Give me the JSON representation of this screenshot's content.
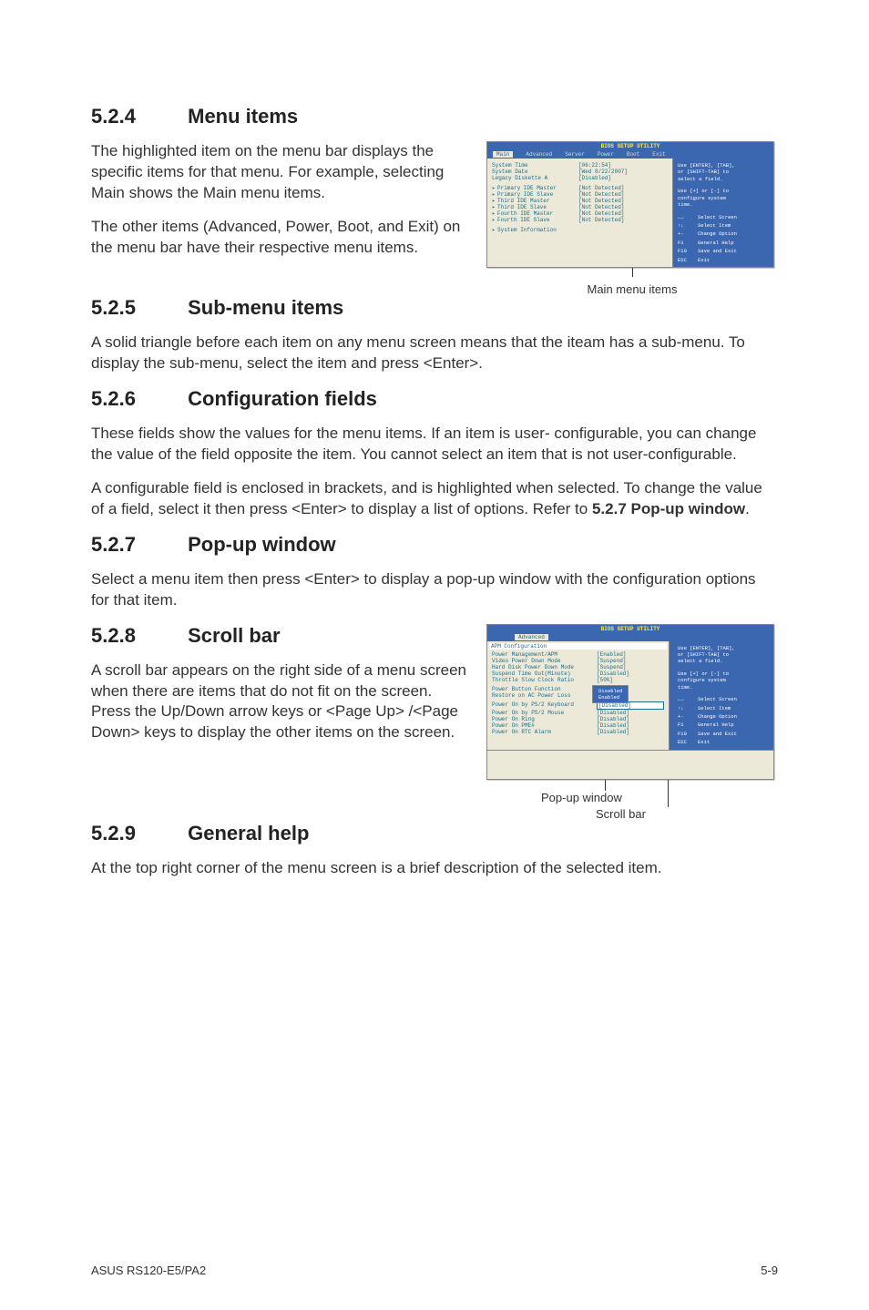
{
  "sections": {
    "s524": {
      "num": "5.2.4",
      "title": "Menu items"
    },
    "s525": {
      "num": "5.2.5",
      "title": "Sub-menu items"
    },
    "s526": {
      "num": "5.2.6",
      "title": "Configuration fields"
    },
    "s527": {
      "num": "5.2.7",
      "title": "Pop-up window"
    },
    "s528": {
      "num": "5.2.8",
      "title": "Scroll bar"
    },
    "s529": {
      "num": "5.2.9",
      "title": "General help"
    }
  },
  "para": {
    "p524a": "The highlighted item on the menu bar displays the specific items for that menu. For example, selecting Main shows the Main menu items.",
    "p524b": "The other items (Advanced, Power, Boot, and Exit) on the menu bar have their respective menu items.",
    "p525": "A solid triangle before each item on any menu screen means that the iteam has a sub-menu. To display the sub-menu, select the item and press <Enter>.",
    "p526a": "These fields show the values for the menu items. If an item is user- configurable, you can change the value of the field opposite the item. You cannot select an item that is not user-configurable.",
    "p526b_pre": "A configurable field is enclosed in brackets, and is highlighted when selected. To change the value of a field, select it then press <Enter> to display a list of options. Refer to ",
    "p526b_bold": "5.2.7 Pop-up window",
    "p526b_post": ".",
    "p527": "Select a menu item then press <Enter> to display a pop-up window with the configuration options for that item.",
    "p528": "A scroll bar appears on the right side of a menu screen when there are items that do not fit on the screen. Press the Up/Down arrow keys or <Page Up> /<Page Down> keys to display the other items on the screen.",
    "p529": "At the top right corner of the menu screen is a brief description of the selected item."
  },
  "fig1": {
    "caption": "Main menu items",
    "title": "BIOS SETUP UTILITY",
    "menus": {
      "main": "Main",
      "advanced": "Advanced",
      "server": "Server",
      "power": "Power",
      "boot": "Boot",
      "exit": "Exit"
    },
    "rows": [
      {
        "lbl": "System Time",
        "val": "[06:22:54]"
      },
      {
        "lbl": "System Date",
        "val": "[Wed 8/22/2007]"
      },
      {
        "lbl": "Legacy Diskette A",
        "val": "[Disabled]"
      }
    ],
    "subrows": [
      {
        "lbl": "Primary IDE Master",
        "val": "[Not Detected]"
      },
      {
        "lbl": "Primary IDE Slave",
        "val": "[Not Detected]"
      },
      {
        "lbl": "Third IDE Master",
        "val": "[Not Detected]"
      },
      {
        "lbl": "Third IDE Slave",
        "val": "[Not Detected]"
      },
      {
        "lbl": "Fourth IDE Master",
        "val": "[Not Detected]"
      },
      {
        "lbl": "Fourth IDE Slave",
        "val": "[Not Detected]"
      }
    ],
    "sysinfo": "System Information",
    "help": {
      "top1": "Use [ENTER], [TAB],",
      "top2": "or [SHIFT-TAB] to",
      "top3": "select a field.",
      "mid1": "Use [+] or [-] to",
      "mid2": "configure system",
      "mid3": "time.",
      "keys": [
        {
          "k": "←→",
          "d": "Select Screen"
        },
        {
          "k": "↑↓",
          "d": "Select Item"
        },
        {
          "k": "+-",
          "d": "Change Option"
        },
        {
          "k": "F1",
          "d": "General Help"
        },
        {
          "k": "F10",
          "d": "Save and Exit"
        },
        {
          "k": "ESC",
          "d": "Exit"
        }
      ]
    }
  },
  "fig2": {
    "caption_popup": "Pop-up window",
    "caption_scroll": "Scroll bar",
    "title": "BIOS SETUP UTILITY",
    "tab": "Advanced",
    "header": "APM Configuration",
    "rows": [
      {
        "lbl": "Power Management/APM",
        "val": "[Enabled]"
      },
      {
        "lbl": "Video Power Down Mode",
        "val": "[Suspend]"
      },
      {
        "lbl": "Hard Disk Power Down Mode",
        "val": "[Suspend]"
      },
      {
        "lbl": "Suspend Time Out(Minute)",
        "val": "[Disabled]"
      },
      {
        "lbl": "Throttle Slow Clock Ratio",
        "val": "[50%]"
      }
    ],
    "rows2": [
      {
        "lbl": "Power Button Function",
        "val": ""
      },
      {
        "lbl": "Restore on AC Power Loss",
        "val": ""
      }
    ],
    "rows3": [
      {
        "lbl": "Power On by PS/2 Keyboard",
        "val": "[Disabled]"
      },
      {
        "lbl": "Power On by PS/2 Mouse",
        "val": "[Disabled]"
      },
      {
        "lbl": "Power On Ring",
        "val": "[Disabled]"
      },
      {
        "lbl": "Power On PME#",
        "val": "[Disabled]"
      },
      {
        "lbl": "Power On RTC Alarm",
        "val": "[Disabled]"
      }
    ],
    "popup": {
      "opt1": "Disabled",
      "opt2": "Enabled"
    },
    "help": {
      "top1": "Use [ENTER], [TAB],",
      "top2": "or [SHIFT-TAB] to",
      "top3": "select a field.",
      "mid1": "Use [+] or [-] to",
      "mid2": "configure system",
      "mid3": "time.",
      "keys": [
        {
          "k": "←→",
          "d": "Select Screen"
        },
        {
          "k": "↑↓",
          "d": "Select Item"
        },
        {
          "k": "+-",
          "d": "Change Option"
        },
        {
          "k": "F1",
          "d": "General Help"
        },
        {
          "k": "F10",
          "d": "Save and Exit"
        },
        {
          "k": "ESC",
          "d": "Exit"
        }
      ]
    }
  },
  "footer": {
    "left": "ASUS RS120-E5/PA2",
    "right": "5-9"
  }
}
